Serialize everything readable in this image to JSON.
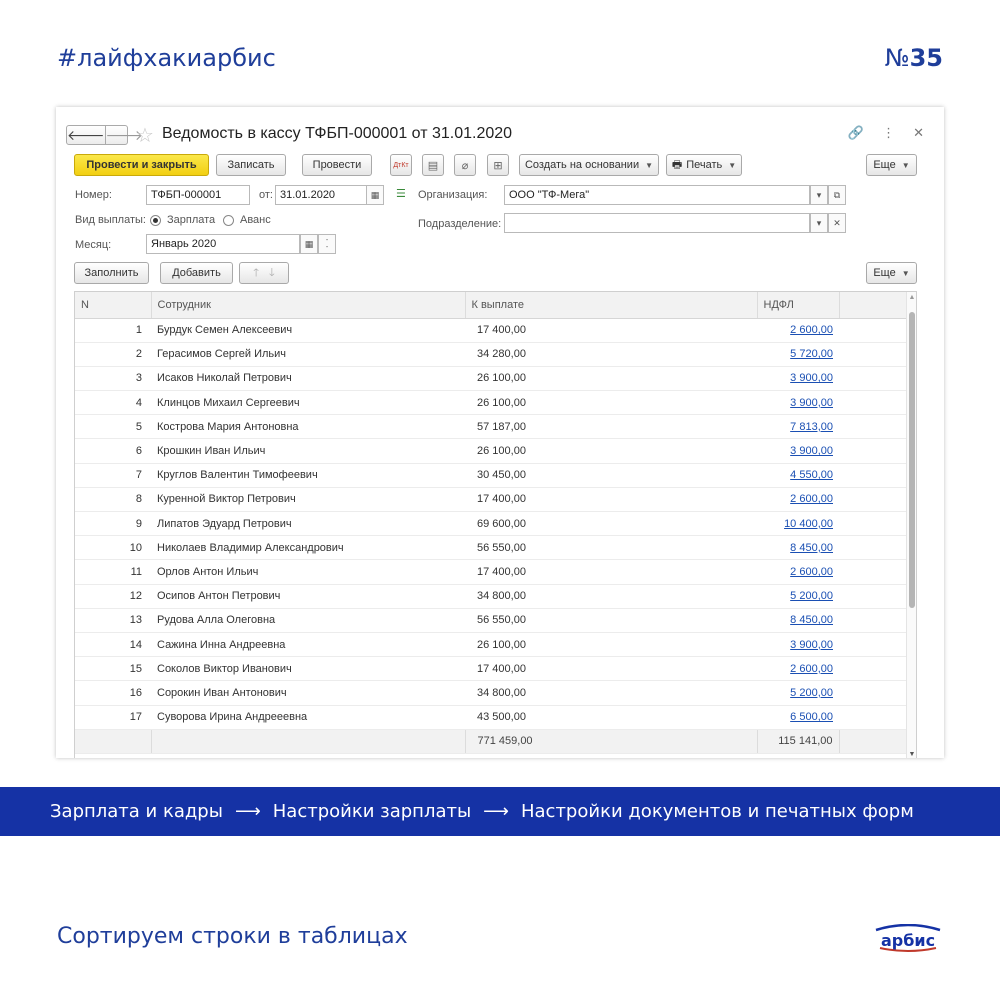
{
  "header": {
    "hashtag": "#лайфхакиарбис",
    "issue_prefix": "№",
    "issue_number": "35"
  },
  "window": {
    "title": "Ведомость в кассу ТФБП-000001 от 31.01.2020",
    "toolbar": {
      "post_close": "Провести и закрыть",
      "save": "Записать",
      "post": "Провести",
      "dtkt_icon": "ДтКт",
      "create_based": "Создать на основании",
      "print": "Печать",
      "more": "Еще"
    },
    "form": {
      "number_label": "Номер:",
      "number_value": "ТФБП-000001",
      "date_label": "от:",
      "date_value": "31.01.2020",
      "org_label": "Организация:",
      "org_value": "ООО \"ТФ-Мега\"",
      "pay_type_label": "Вид выплаты:",
      "pay_type_options": [
        "Зарплата",
        "Аванс"
      ],
      "pay_type_selected": "Зарплата",
      "division_label": "Подразделение:",
      "division_value": "",
      "month_label": "Месяц:",
      "month_value": "Январь 2020"
    },
    "table_toolbar": {
      "fill": "Заполнить",
      "add": "Добавить",
      "more": "Еще"
    },
    "table": {
      "columns": [
        "N",
        "Сотрудник",
        "К выплате",
        "НДФЛ"
      ],
      "rows": [
        {
          "n": "1",
          "name": "Бурдук Семен Алексеевич",
          "pay": "17 400,00",
          "ndfl": "2 600,00"
        },
        {
          "n": "2",
          "name": "Герасимов Сергей Ильич",
          "pay": "34 280,00",
          "ndfl": "5 720,00"
        },
        {
          "n": "3",
          "name": "Исаков Николай Петрович",
          "pay": "26 100,00",
          "ndfl": "3 900,00"
        },
        {
          "n": "4",
          "name": "Клинцов Михаил Сергеевич",
          "pay": "26 100,00",
          "ndfl": "3 900,00"
        },
        {
          "n": "5",
          "name": "Кострова Мария Антоновна",
          "pay": "57 187,00",
          "ndfl": "7 813,00"
        },
        {
          "n": "6",
          "name": "Крошкин Иван Ильич",
          "pay": "26 100,00",
          "ndfl": "3 900,00"
        },
        {
          "n": "7",
          "name": "Круглов Валентин Тимофеевич",
          "pay": "30 450,00",
          "ndfl": "4 550,00"
        },
        {
          "n": "8",
          "name": "Куренной Виктор Петрович",
          "pay": "17 400,00",
          "ndfl": "2 600,00"
        },
        {
          "n": "9",
          "name": "Липатов Эдуард Петрович",
          "pay": "69 600,00",
          "ndfl": "10 400,00"
        },
        {
          "n": "10",
          "name": "Николаев Владимир Александрович",
          "pay": "56 550,00",
          "ndfl": "8 450,00"
        },
        {
          "n": "11",
          "name": "Орлов Антон Ильич",
          "pay": "17 400,00",
          "ndfl": "2 600,00"
        },
        {
          "n": "12",
          "name": "Осипов Антон Петрович",
          "pay": "34 800,00",
          "ndfl": "5 200,00"
        },
        {
          "n": "13",
          "name": "Рудова Алла Олеговна",
          "pay": "56 550,00",
          "ndfl": "8 450,00"
        },
        {
          "n": "14",
          "name": "Сажина Инна Андреевна",
          "pay": "26 100,00",
          "ndfl": "3 900,00"
        },
        {
          "n": "15",
          "name": "Соколов Виктор Иванович",
          "pay": "17 400,00",
          "ndfl": "2 600,00"
        },
        {
          "n": "16",
          "name": "Сорокин Иван Антонович",
          "pay": "34 800,00",
          "ndfl": "5 200,00"
        },
        {
          "n": "17",
          "name": "Суворова Ирина Андрееевна",
          "pay": "43 500,00",
          "ndfl": "6 500,00"
        }
      ],
      "total_pay": "771 459,00",
      "total_ndfl": "115 141,00"
    }
  },
  "banner": {
    "path": [
      "Зарплата и кадры",
      "Настройки зарплаты",
      "Настройки документов и печатных форм"
    ],
    "arrow": "⟶"
  },
  "footer": {
    "caption": "Сортируем строки в таблицах",
    "logo_text": "арбис"
  },
  "colors": {
    "brand_blue": "#1532a5",
    "accent_yellow": "#f2cf12",
    "link_blue": "#1a4fb3"
  },
  "icons": [
    "back-arrow-icon",
    "forward-arrow-icon",
    "star-icon",
    "link-icon",
    "more-vert-icon",
    "close-icon",
    "calendar-icon",
    "document-icon",
    "paperclip-icon",
    "structure-icon",
    "printer-icon",
    "open-icon",
    "arrow-up-icon",
    "arrow-down-icon"
  ]
}
